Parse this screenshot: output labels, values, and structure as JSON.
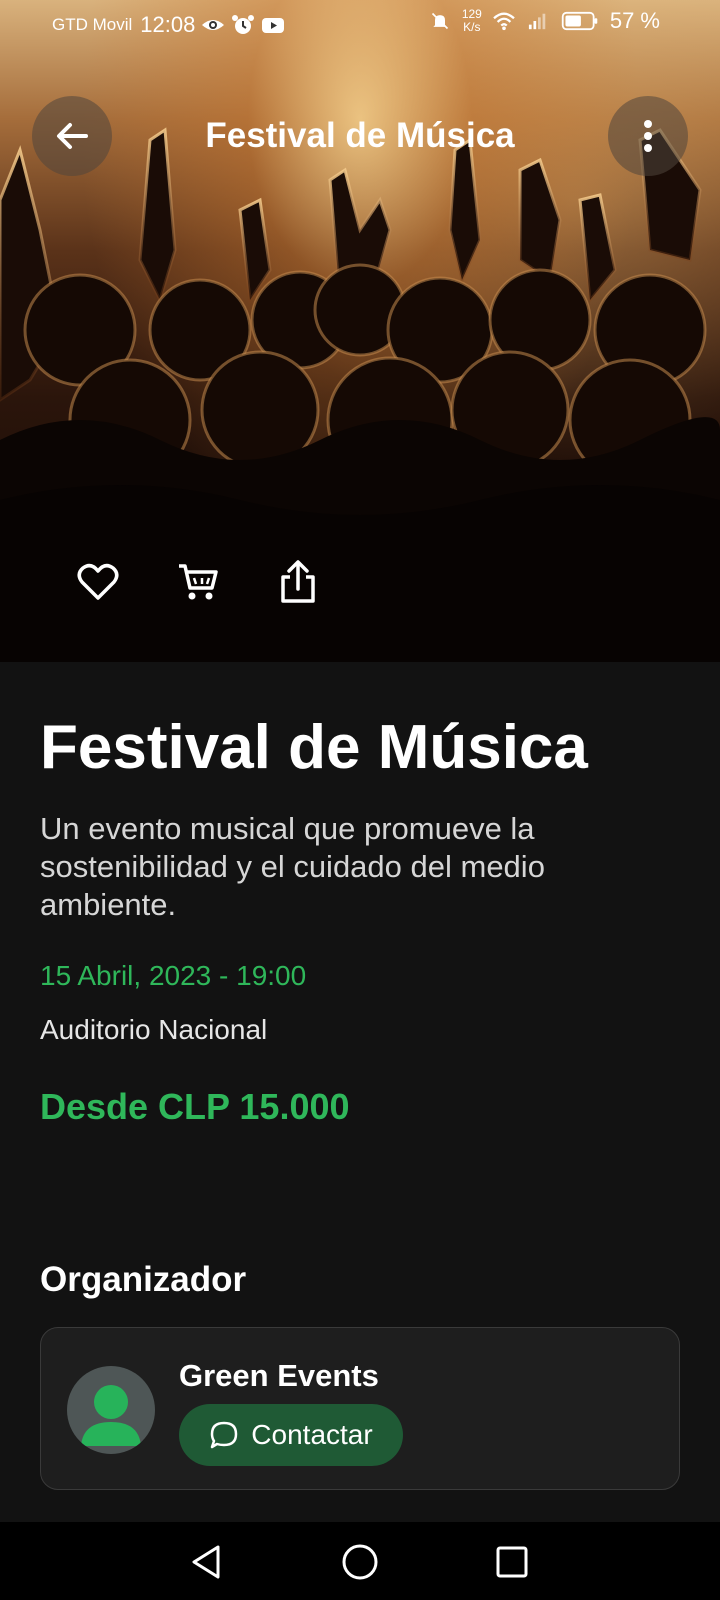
{
  "status_bar": {
    "carrier": "GTD Movil",
    "time": "12:08",
    "net_speed_value": "129",
    "net_speed_unit": "K/s",
    "battery_percent": "57 %",
    "icons": [
      "eye-icon",
      "alarm-icon",
      "youtube-icon",
      "bell-off-icon",
      "wifi-icon",
      "signal-icon",
      "battery-icon"
    ]
  },
  "header": {
    "title": "Festival de Música",
    "back_icon": "arrow-left-icon",
    "menu_icon": "more-vertical-icon"
  },
  "hero": {
    "image": "concert-crowd-photo",
    "actions": [
      "heart-icon",
      "cart-icon",
      "share-icon"
    ]
  },
  "event": {
    "title": "Festival de Música",
    "description": "Un evento musical que promueve la sostenibilidad y el cuidado del medio ambiente.",
    "datetime": "15 Abril, 2023 - 19:00",
    "venue": "Auditorio Nacional",
    "price": "Desde CLP 15.000"
  },
  "organizer": {
    "heading": "Organizador",
    "name": "Green Events",
    "contact_label": "Contactar",
    "avatar_icon": "person-icon",
    "contact_icon": "chat-bubble-icon"
  },
  "nav": {
    "icons": [
      "back-triangle-icon",
      "home-circle-icon",
      "recents-square-icon"
    ]
  },
  "colors": {
    "accent": "#2fb75a",
    "background": "#121212",
    "card": "#1e1e1e",
    "contact_button": "#1f5a35"
  }
}
